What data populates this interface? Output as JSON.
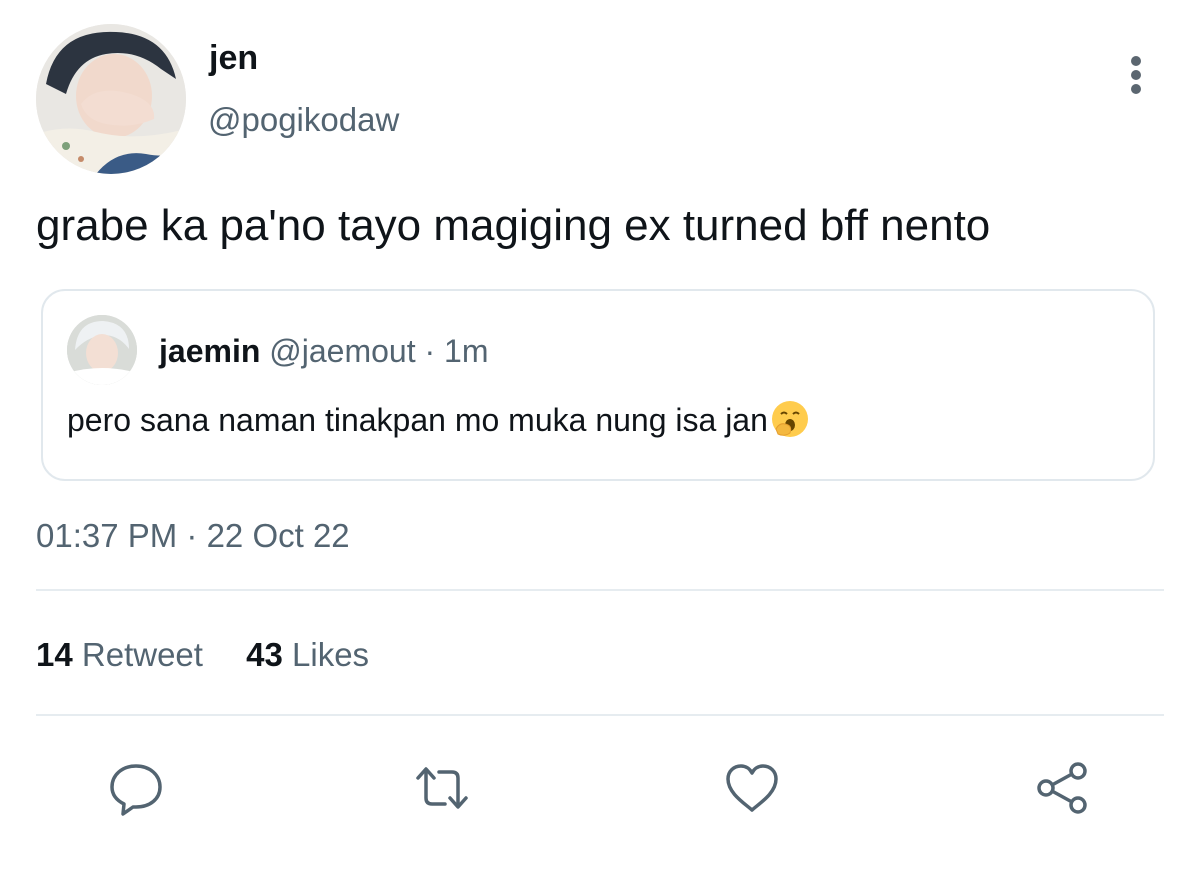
{
  "author": {
    "display_name": "jen",
    "handle": "@pogikodaw"
  },
  "tweet": {
    "text": "grabe ka pa'no tayo magiging ex turned bff nento",
    "timestamp": "01:37 PM · 22 Oct 22"
  },
  "quoted_tweet": {
    "display_name": "jaemin",
    "handle": "@jaemout",
    "separator": "·",
    "time": "1m",
    "text": "pero sana naman tinakpan mo muka nung isa jan",
    "emoji": "yawning-face-emoji"
  },
  "stats": {
    "retweets_count": "14",
    "retweets_label": "Retweet",
    "likes_count": "43",
    "likes_label": "Likes"
  },
  "actions": {
    "reply_icon": "reply-icon",
    "retweet_icon": "retweet-icon",
    "like_icon": "heart-icon",
    "share_icon": "share-icon"
  },
  "colors": {
    "text_primary": "#0f1419",
    "text_secondary": "#536471",
    "border": "#e1e8ed"
  }
}
